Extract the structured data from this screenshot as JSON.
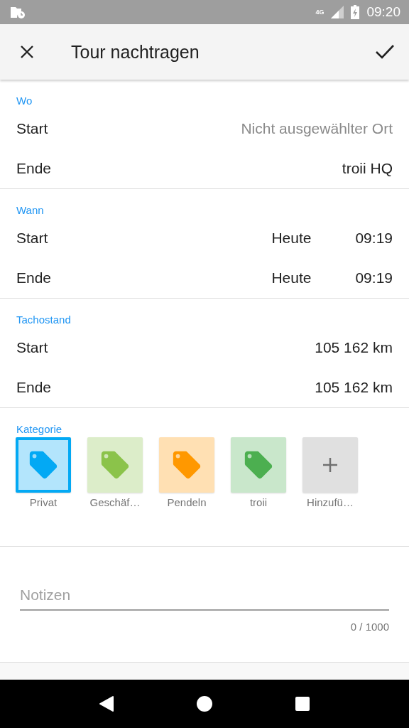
{
  "status_bar": {
    "time": "09:20",
    "network": "4G"
  },
  "app_bar": {
    "title": "Tour nachtragen"
  },
  "sections": [
    {
      "title": "Wo",
      "rows": [
        {
          "label": "Start",
          "values": [
            {
              "text": "Nicht ausgewählter Ort",
              "empty": true
            }
          ]
        },
        {
          "label": "Ende",
          "values": [
            {
              "text": "troii HQ",
              "empty": false
            }
          ]
        }
      ]
    },
    {
      "title": "Wann",
      "rows": [
        {
          "label": "Start",
          "values": [
            {
              "text": "Heute",
              "empty": false
            },
            {
              "text": "09:19",
              "empty": false
            }
          ]
        },
        {
          "label": "Ende",
          "values": [
            {
              "text": "Heute",
              "empty": false
            },
            {
              "text": "09:19",
              "empty": false
            }
          ]
        }
      ]
    },
    {
      "title": "Tachostand",
      "rows": [
        {
          "label": "Start",
          "values": [
            {
              "text": "105 162 km",
              "empty": false
            }
          ]
        },
        {
          "label": "Ende",
          "values": [
            {
              "text": "105 162 km",
              "empty": false
            }
          ]
        }
      ]
    }
  ],
  "category": {
    "title": "Kategorie",
    "items": [
      {
        "kind": "category",
        "label": "Privat",
        "color": "#03a9f4",
        "selected": true
      },
      {
        "kind": "category",
        "label": "Geschäf…",
        "color": "#8bc34a",
        "selected": false
      },
      {
        "kind": "category",
        "label": "Pendeln",
        "color": "#ff9800",
        "selected": false
      },
      {
        "kind": "category",
        "label": "troii",
        "color": "#4caf50",
        "selected": false
      },
      {
        "kind": "add",
        "label": "Hinzufü…",
        "selected": false
      }
    ]
  },
  "notes": {
    "placeholder": "Notizen",
    "counter": "0 / 1000"
  }
}
